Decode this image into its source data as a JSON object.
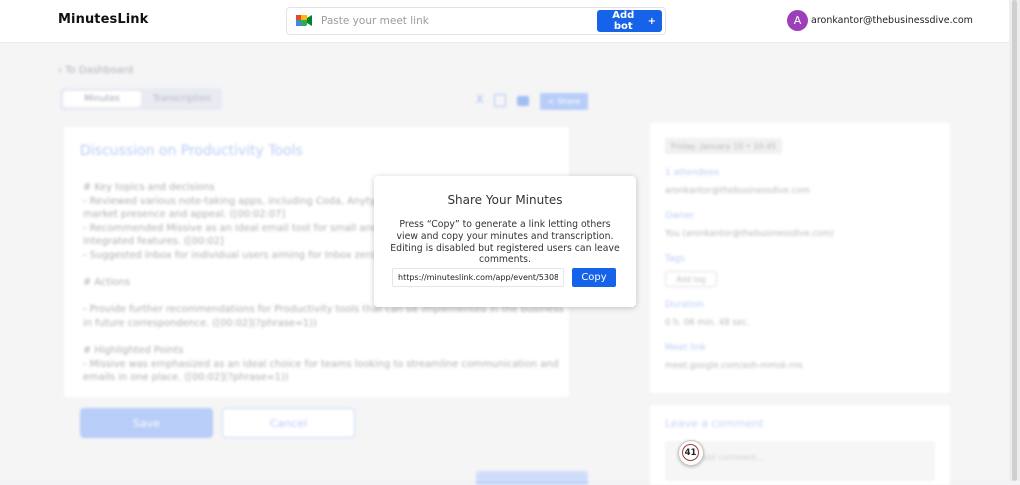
{
  "header": {
    "logo_text": "MinutesLink",
    "meet_input_placeholder": "Paste your meet link",
    "meet_input_value": "",
    "add_bot_label": "Add bot",
    "add_bot_icon": "+",
    "avatar_letter": "A",
    "user_email": "aronkantor@thebusinessdive.com"
  },
  "background": {
    "back_link": "To Dashboard",
    "tabs": [
      {
        "label": "Minutes",
        "active": true
      },
      {
        "label": "Transcription",
        "active": false
      }
    ],
    "toolbar": {
      "x_label": "X",
      "share_label": "Share"
    },
    "minutes_title": "Discussion on Productivity Tools",
    "minutes_body": "# Key topics and decisions\n- Reviewed various note-taking apps, including Coda, Anytype, ...\nmarket presence and appeal. ([00:02:07]\n- Recommended Missive as an ideal email tool for small and ...\nintegrated features. ([00:02]\n- Suggested Inbox for individual users aiming for Inbox zero.\n\n# Actions\n\n- Provide further recommendations for Productivity tools that can be implemented in the business\nin future correspondence. ([00:02](?phrase=1))\n\n# Highlighted Points\n- Missive was emphasized as an ideal choice for teams looking to streamline communication and\nemails in one place. ([00:02](?phrase=1))",
    "save_label": "Save",
    "cancel_label": "Cancel",
    "side": {
      "date": "Friday, January 10  •  10:45",
      "attendees_label": "1 attendees",
      "attendee": "aronkantor@thebusinessdive.com",
      "owner_label": "Owner",
      "owner_value": "You (aronkantor@thebusinessdive.com)",
      "tags_label": "Tags",
      "tag_button": "Add tag",
      "duration_label": "Duration",
      "duration_value": "0 h.  06 min.  48 sec.",
      "meet_link_label": "Meet link",
      "meet_link_value": "meet.google.com/ash-mmsk-rns"
    },
    "comment_title": "Leave a comment",
    "comment_placeholder": "Add comment..."
  },
  "modal": {
    "title": "Share Your Minutes",
    "description": "Press “Copy” to generate a link letting others view and copy your minutes and transcription. Editing is disabled but registered users can leave comments.",
    "link_value": "https://minuteslink.com/app/event/5308dff3-",
    "copy_label": "Copy"
  },
  "notification_badge": {
    "count": "41"
  },
  "colors": {
    "accent": "#1662e8",
    "avatar": "#9c3fb8"
  }
}
